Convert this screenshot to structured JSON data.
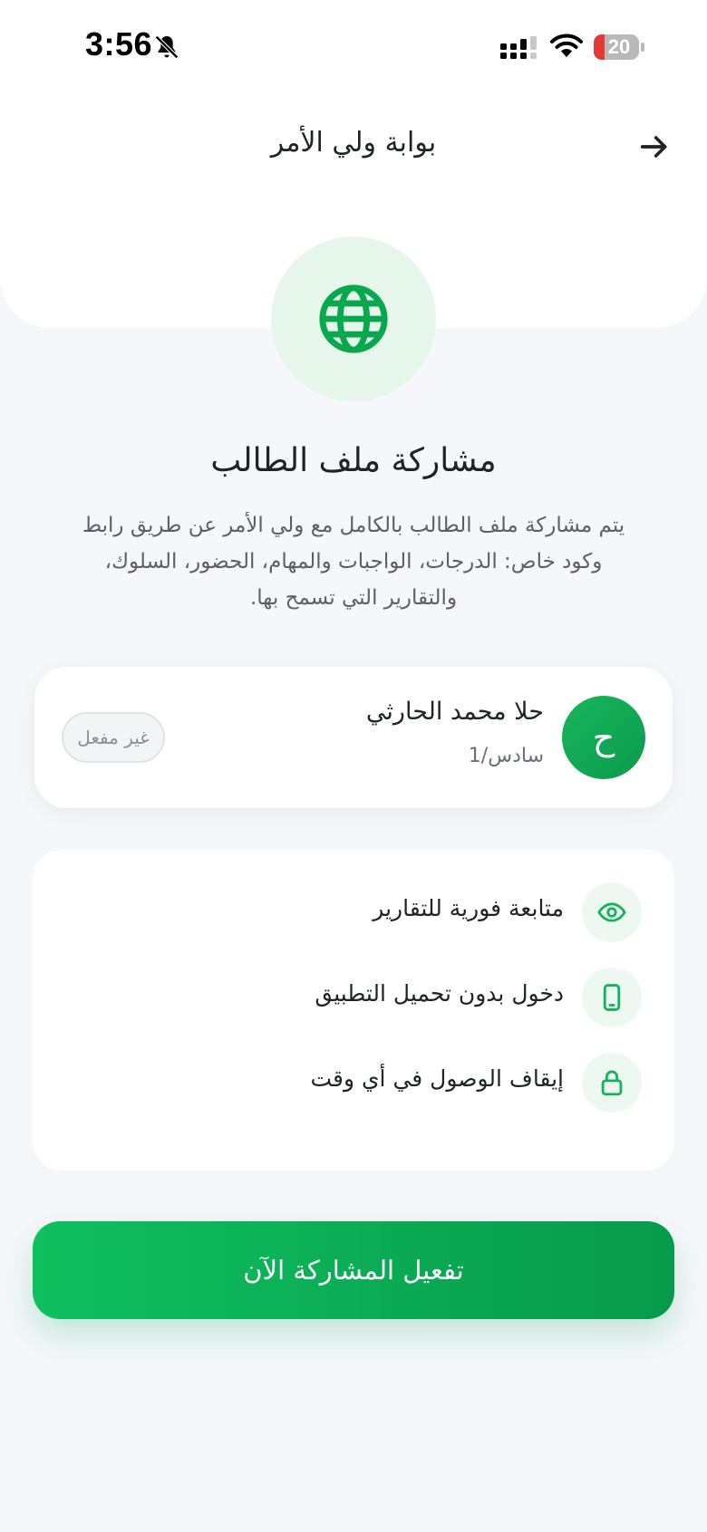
{
  "status_bar": {
    "time": "3:56",
    "battery_level": "20",
    "icons": [
      "bell-off-icon",
      "signal-icon",
      "wifi-icon",
      "battery-icon"
    ]
  },
  "header": {
    "title": "بوابة ولي الأمر",
    "back_icon": "arrow-right-icon"
  },
  "hero": {
    "icon": "globe-icon",
    "title": "مشاركة ملف الطالب",
    "description": "يتم مشاركة ملف الطالب بالكامل مع ولي الأمر عن طريق رابط وكود خاص: الدرجات، الواجبات والمهام، الحضور، السلوك، والتقارير التي تسمح بها."
  },
  "student": {
    "initial": "ح",
    "name": "حلا محمد الحارثي",
    "class": "سادس/1",
    "status": "غير مفعل"
  },
  "features": [
    {
      "icon": "eye-icon",
      "label": "متابعة فورية للتقارير"
    },
    {
      "icon": "phone-icon",
      "label": "دخول بدون تحميل التطبيق"
    },
    {
      "icon": "lock-icon",
      "label": "إيقاف الوصول في أي وقت"
    }
  ],
  "cta": {
    "label": "تفعيل المشاركة الآن"
  },
  "colors": {
    "accent": "#0fc05f",
    "accent_dark": "#079a4c",
    "accent_light": "#e6f6ea",
    "background": "#f6f7fb"
  }
}
